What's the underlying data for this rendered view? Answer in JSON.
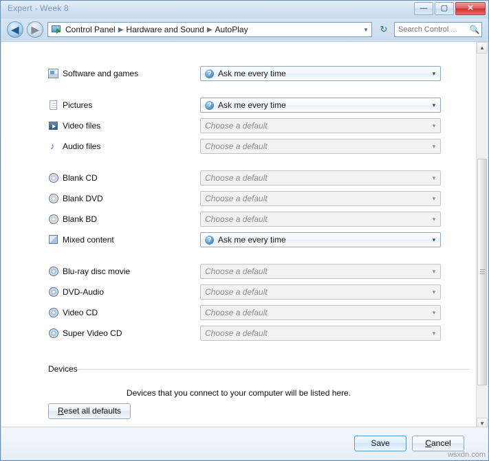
{
  "window": {
    "title": "Expert - Week 8",
    "buttons": {
      "minimize": "—",
      "maximize": "▢",
      "close": "✕"
    }
  },
  "addressbar": {
    "back_icon": "◀",
    "forward_icon": "▶",
    "dropdown_icon": "▾",
    "refresh_icon": "↻",
    "breadcrumb": [
      "Control Panel",
      "Hardware and Sound",
      "AutoPlay"
    ],
    "separator": "▶",
    "search_placeholder": "Search Control ...",
    "search_value": "",
    "search_icon": "🔍"
  },
  "media_rows": [
    {
      "label": "Software and games",
      "icon": "software-icon",
      "value": "Ask me every time",
      "state": "active",
      "has_help_icon": true
    },
    {
      "label": "Pictures",
      "icon": "picture-icon",
      "value": "Ask me every time",
      "state": "active",
      "has_help_icon": true
    },
    {
      "label": "Video files",
      "icon": "video-icon",
      "value": "Choose a default",
      "state": "disabled",
      "has_help_icon": false
    },
    {
      "label": "Audio files",
      "icon": "audio-icon",
      "value": "Choose a default",
      "state": "disabled",
      "has_help_icon": false
    },
    {
      "label": "Blank CD",
      "icon": "disc-icon",
      "value": "Choose a default",
      "state": "disabled",
      "has_help_icon": false
    },
    {
      "label": "Blank DVD",
      "icon": "disc-icon",
      "value": "Choose a default",
      "state": "disabled",
      "has_help_icon": false
    },
    {
      "label": "Blank BD",
      "icon": "disc-icon",
      "value": "Choose a default",
      "state": "disabled",
      "has_help_icon": false
    },
    {
      "label": "Mixed content",
      "icon": "mixed-content-icon",
      "value": "Ask me every time",
      "state": "active",
      "has_help_icon": true
    },
    {
      "label": "Blu-ray disc movie",
      "icon": "bluray-disc-icon",
      "value": "Choose a default",
      "state": "disabled",
      "has_help_icon": false
    },
    {
      "label": "DVD-Audio",
      "icon": "dvd-audio-icon",
      "value": "Choose a default",
      "state": "disabled",
      "has_help_icon": false
    },
    {
      "label": "Video CD",
      "icon": "video-cd-icon",
      "value": "Choose a default",
      "state": "disabled",
      "has_help_icon": false
    },
    {
      "label": "Super Video CD",
      "icon": "super-video-cd-icon",
      "value": "Choose a default",
      "state": "disabled",
      "has_help_icon": false
    }
  ],
  "combo_arrow": "▾",
  "help_glyph": "?",
  "devices": {
    "heading": "Devices",
    "note": "Devices that you connect to your computer will be listed here.",
    "reset_label": "Reset all defaults",
    "reset_mnemonic": "R"
  },
  "footer": {
    "save_label": "Save",
    "cancel_label": "Cancel",
    "cancel_mnemonic": "C"
  },
  "scrollbar": {
    "up_arrow": "▲",
    "down_arrow": "▼"
  },
  "watermark": "wsxdn.com",
  "colors": {
    "accent": "#2b6fa8",
    "close_button": "#cf2f2f",
    "frame": "#6a8ba8"
  }
}
